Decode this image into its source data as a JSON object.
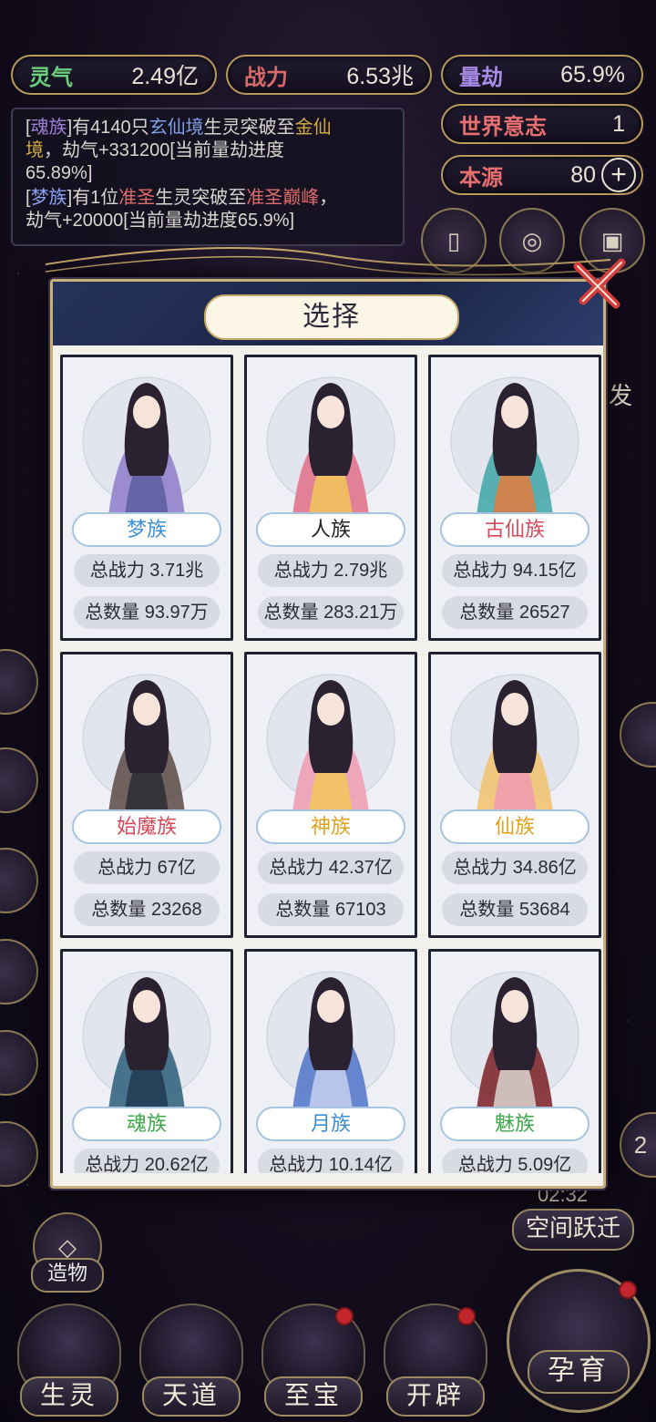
{
  "top_stats": {
    "lingqi": {
      "label": "灵气",
      "value": "2.49亿",
      "label_color": "#6ad07a"
    },
    "zhanli": {
      "label": "战力",
      "value": "6.53兆",
      "label_color": "#d86a6a"
    },
    "liangjie": {
      "label": "量劫",
      "value": "65.9%",
      "label_color": "#a98ce8"
    },
    "shijie": {
      "label": "世界意志",
      "value": "1",
      "label_color": "#e76f6f"
    },
    "benyuan": {
      "label": "本源",
      "value": "80",
      "label_color": "#e76f6f"
    }
  },
  "log": {
    "line1": {
      "open": "[",
      "race": "魂族",
      "t1": "]有4140只",
      "realm1": "玄仙境",
      "t2": "生灵突破至",
      "realm2": "金仙",
      "realm2b": "境",
      "t3": "，劫气+331200[当前量劫进度",
      "t4": "65.89%]"
    },
    "line2": {
      "open": "[",
      "race": "梦族",
      "t1": "]有1位",
      "realm1": "准圣",
      "t2": "生灵突破至",
      "realm2": "准圣巅峰",
      "t3": "，",
      "t4": "劫气+20000[当前量劫进度65.9%]"
    }
  },
  "side": {
    "right_label": "发",
    "left_labels": [
      "造物"
    ],
    "timer": "02:32",
    "jump_button": "空间跃迁",
    "badge_number": "2"
  },
  "modal": {
    "title": "选择",
    "cards": [
      {
        "name": "梦族",
        "name_color": "#3d8fd6",
        "power": "总战力 3.71兆",
        "count": "总数量 93.97万",
        "palette": [
          "#8d7cc9",
          "#5a5da0"
        ]
      },
      {
        "name": "人族",
        "name_color": "#222222",
        "power": "总战力 2.79兆",
        "count": "总数量 283.21万",
        "palette": [
          "#e06e86",
          "#f2c75a"
        ]
      },
      {
        "name": "古仙族",
        "name_color": "#d6485a",
        "power": "总战力 94.15亿",
        "count": "总数量 26527",
        "palette": [
          "#3fa6a6",
          "#e37a3d"
        ]
      },
      {
        "name": "始魔族",
        "name_color": "#d6485a",
        "power": "总战力 67亿",
        "count": "总数量 23268",
        "palette": [
          "#5a4a44",
          "#2d2d33"
        ]
      },
      {
        "name": "神族",
        "name_color": "#e0a21e",
        "power": "总战力 42.37亿",
        "count": "总数量 67103",
        "palette": [
          "#ef9bb0",
          "#f2c75a"
        ]
      },
      {
        "name": "仙族",
        "name_color": "#e0a21e",
        "power": "总战力 34.86亿",
        "count": "总数量 53684",
        "palette": [
          "#f2c26a",
          "#f19ab0"
        ]
      },
      {
        "name": "魂族",
        "name_color": "#3daa4a",
        "power": "总战力 20.62亿",
        "count": "",
        "palette": [
          "#2d5d7a",
          "#1e3b52"
        ]
      },
      {
        "name": "月族",
        "name_color": "#3d8fd6",
        "power": "总战力 10.14亿",
        "count": "",
        "palette": [
          "#4f76c9",
          "#c7d0ef"
        ]
      },
      {
        "name": "魅族",
        "name_color": "#3daa4a",
        "power": "总战力 5.09亿",
        "count": "",
        "palette": [
          "#7a1f25",
          "#d9d3cd"
        ]
      }
    ]
  },
  "bottom_nav": [
    {
      "label": "生灵",
      "dot": false
    },
    {
      "label": "天道",
      "dot": false
    },
    {
      "label": "至宝",
      "dot": true
    },
    {
      "label": "开辟",
      "dot": true
    },
    {
      "label": "孕育",
      "dot": true
    }
  ]
}
